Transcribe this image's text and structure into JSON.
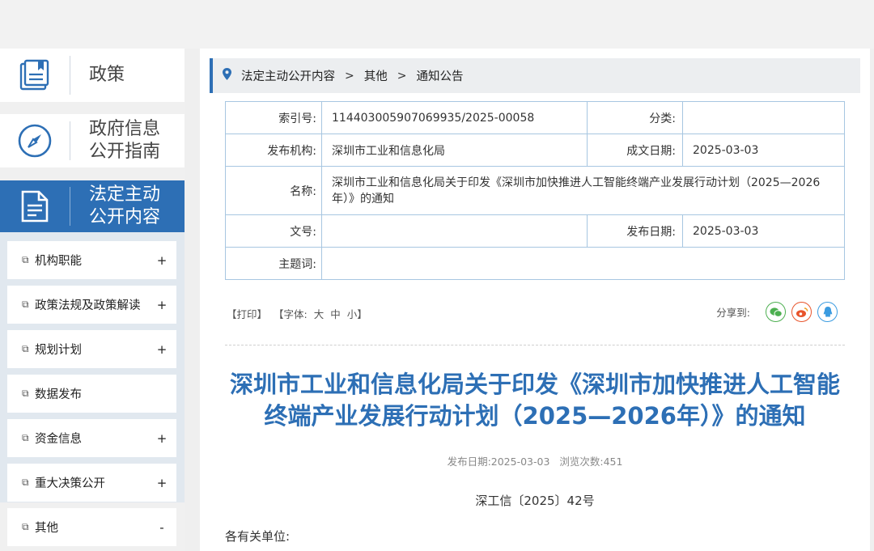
{
  "sidebar": {
    "big_nav": [
      {
        "label": "政策",
        "icon": "book-icon"
      },
      {
        "label": "政府信息公开指南",
        "line1": "政府信息",
        "line2": "公开指南",
        "icon": "compass-icon"
      },
      {
        "label": "法定主动公开内容",
        "line1": "法定主动",
        "line2": "公开内容",
        "icon": "document-icon"
      }
    ],
    "items": [
      {
        "label": "机构职能",
        "toggle": "+"
      },
      {
        "label": "政策法规及政策解读",
        "toggle": "+"
      },
      {
        "label": "规划计划",
        "toggle": "+"
      },
      {
        "label": "数据发布",
        "toggle": ""
      },
      {
        "label": "资金信息",
        "toggle": "+"
      },
      {
        "label": "重大决策公开",
        "toggle": "+"
      },
      {
        "label": "其他",
        "toggle": "-"
      }
    ]
  },
  "breadcrumb": {
    "items": [
      "法定主动公开内容",
      "其他",
      "通知公告"
    ],
    "separator": ">"
  },
  "info": {
    "index_label": "索引号:",
    "index_value": "114403005907069935/2025-00058",
    "category_label": "分类:",
    "category_value": "",
    "publisher_label": "发布机构:",
    "publisher_value": "深圳市工业和信息化局",
    "written_date_label": "成文日期:",
    "written_date_value": "2025-03-03",
    "name_label": "名称:",
    "name_value": "深圳市工业和信息化局关于印发《深圳市加快推进人工智能终端产业发展行动计划（2025—2026年）》的通知",
    "doc_no_label": "文号:",
    "doc_no_value": "",
    "publish_date_label": "发布日期:",
    "publish_date_value": "2025-03-03",
    "keywords_label": "主题词:",
    "keywords_value": ""
  },
  "tools": {
    "print": "【打印】",
    "font_prefix": "【字体:",
    "font_large": "大",
    "font_medium": "中",
    "font_small": "小】",
    "share_label": "分享到:"
  },
  "share_icons": [
    {
      "name": "wechat-icon",
      "color": "#4caf50"
    },
    {
      "name": "weibo-icon",
      "color": "#e8542b"
    },
    {
      "name": "qq-icon",
      "color": "#3a9be0"
    }
  ],
  "document": {
    "title": "深圳市工业和信息化局关于印发《深圳市加快推进人工智能终端产业发展行动计划（2025—2026年）》的通知",
    "meta_date_label": "发布日期:",
    "meta_date": "2025-03-03",
    "meta_views_label": "浏览次数:",
    "meta_views": "451",
    "doc_number": "深工信〔2025〕42号",
    "greeting": "各有关单位:"
  },
  "colors": {
    "accent": "#2d6fb5",
    "table_border": "#a7c6e1",
    "sub_menu_bg": "#e1e8ef"
  }
}
